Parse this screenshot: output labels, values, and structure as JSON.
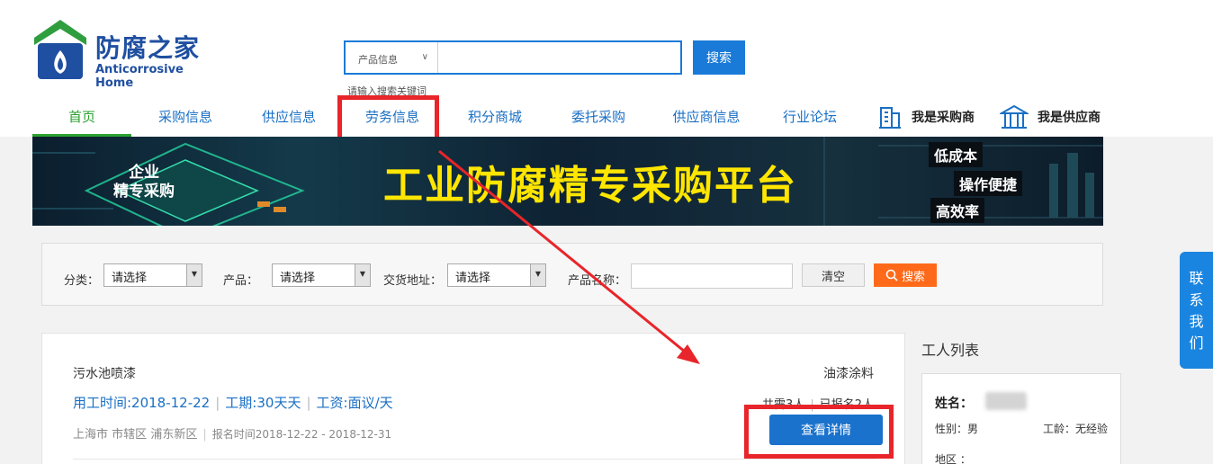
{
  "logo": {
    "cn": "防腐之家",
    "en": "Anticorrosive Home"
  },
  "search": {
    "category": "产品信息",
    "chevron": "∨",
    "placeholder": "",
    "button": "搜索",
    "hint": "请输入搜索关键词"
  },
  "nav": {
    "items": [
      {
        "label": "首页"
      },
      {
        "label": "采购信息"
      },
      {
        "label": "供应信息"
      },
      {
        "label": "劳务信息"
      },
      {
        "label": "积分商城"
      },
      {
        "label": "委托采购"
      },
      {
        "label": "供应商信息"
      },
      {
        "label": "行业论坛"
      }
    ],
    "buyer": "我是采购商",
    "supplier": "我是供应商"
  },
  "banner": {
    "title": "工业防腐精专采购平台",
    "left_line1": "企业",
    "left_line2": "精专采购",
    "tag1": "低成本",
    "tag2": "操作便捷",
    "tag3": "高效率"
  },
  "filter": {
    "category_label": "分类：",
    "category_value": "请选择",
    "product_label": "产品：",
    "product_value": "请选择",
    "address_label": "交货地址：",
    "address_value": "请选择",
    "name_label": "产品名称：",
    "clear": "清空",
    "search": "搜索"
  },
  "job": {
    "title": "污水池喷漆",
    "category": "油漆涂料",
    "work_time": "用工时间:2018-12-22",
    "period": "工期:30天天",
    "wage": "工资:面议/天",
    "needed": "共需3人",
    "signed": "已报名2人",
    "city": "上海市",
    "district": "市辖区",
    "area": "浦东新区",
    "signup_time": "报名时间2018-12-22 - 2018-12-31",
    "detail_button": "查看详情"
  },
  "sidebar": {
    "title": "工人列表",
    "name_label": "姓名：",
    "gender": "性别：男",
    "experience": "工龄：无经验",
    "area": "地区 ："
  },
  "contact": {
    "label": "联系我们"
  },
  "colors": {
    "brand_blue": "#1a7ad8",
    "nav_active": "#2aa12f",
    "highlight_red": "#e8252a",
    "search_orange": "#ff6a1a",
    "banner_yellow": "#ffe600"
  }
}
